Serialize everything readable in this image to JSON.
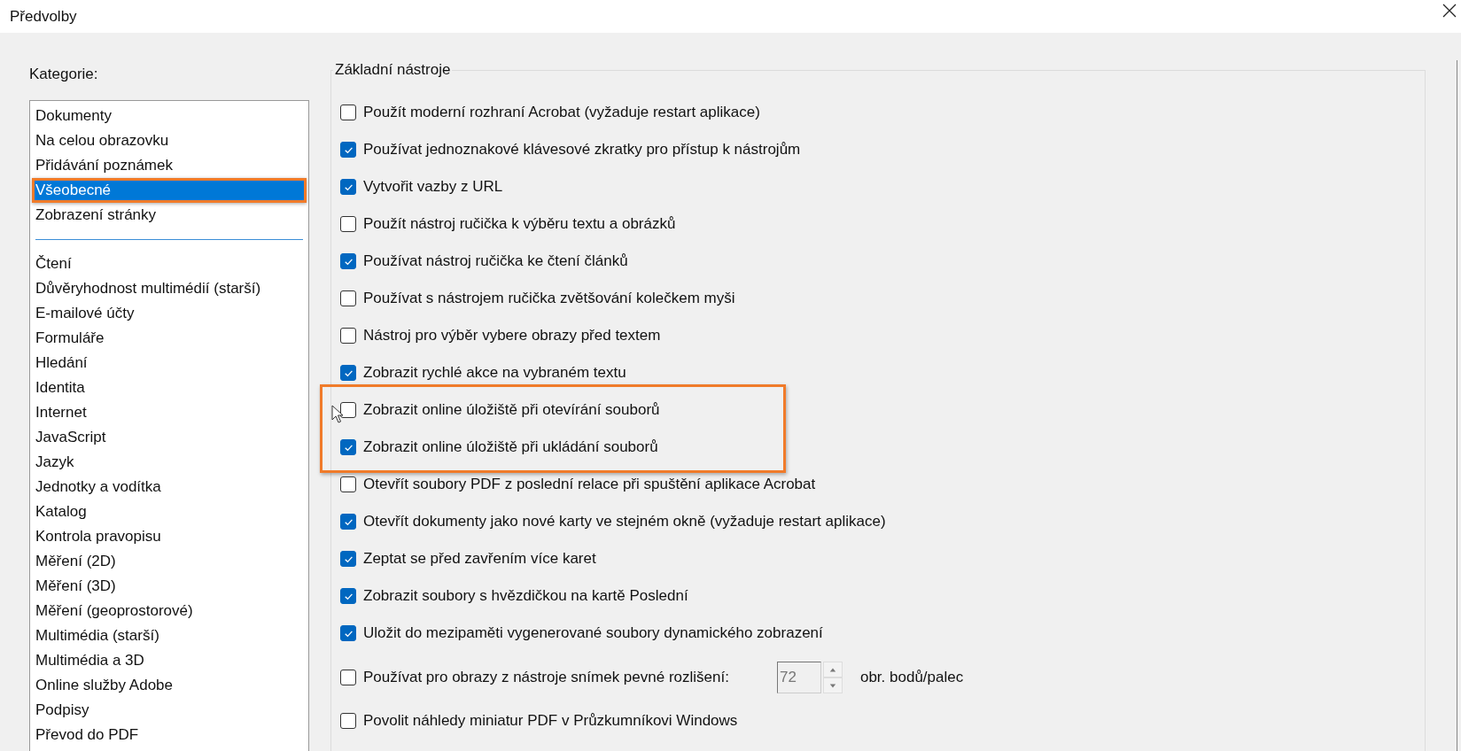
{
  "window": {
    "title": "Předvolby"
  },
  "categories": {
    "label": "Kategorie:",
    "groups": [
      {
        "items": [
          {
            "label": "Dokumenty",
            "selected": false,
            "highlighted": false
          },
          {
            "label": "Na celou obrazovku",
            "selected": false,
            "highlighted": false
          },
          {
            "label": "Přidávání poznámek",
            "selected": false,
            "highlighted": false
          },
          {
            "label": "Všeobecné",
            "selected": true,
            "highlighted": true
          },
          {
            "label": "Zobrazení stránky",
            "selected": false,
            "highlighted": false
          }
        ]
      },
      {
        "items": [
          {
            "label": "Čtení",
            "selected": false,
            "highlighted": false
          },
          {
            "label": "Důvěryhodnost multimédií (starší)",
            "selected": false,
            "highlighted": false
          },
          {
            "label": "E-mailové účty",
            "selected": false,
            "highlighted": false
          },
          {
            "label": "Formuláře",
            "selected": false,
            "highlighted": false
          },
          {
            "label": "Hledání",
            "selected": false,
            "highlighted": false
          },
          {
            "label": "Identita",
            "selected": false,
            "highlighted": false
          },
          {
            "label": "Internet",
            "selected": false,
            "highlighted": false
          },
          {
            "label": "JavaScript",
            "selected": false,
            "highlighted": false
          },
          {
            "label": "Jazyk",
            "selected": false,
            "highlighted": false
          },
          {
            "label": "Jednotky a vodítka",
            "selected": false,
            "highlighted": false
          },
          {
            "label": "Katalog",
            "selected": false,
            "highlighted": false
          },
          {
            "label": "Kontrola pravopisu",
            "selected": false,
            "highlighted": false
          },
          {
            "label": "Měření (2D)",
            "selected": false,
            "highlighted": false
          },
          {
            "label": "Měření (3D)",
            "selected": false,
            "highlighted": false
          },
          {
            "label": "Měření (geoprostorové)",
            "selected": false,
            "highlighted": false
          },
          {
            "label": "Multimédia (starší)",
            "selected": false,
            "highlighted": false
          },
          {
            "label": "Multimédia a 3D",
            "selected": false,
            "highlighted": false
          },
          {
            "label": "Online služby Adobe",
            "selected": false,
            "highlighted": false
          },
          {
            "label": "Podpisy",
            "selected": false,
            "highlighted": false
          },
          {
            "label": "Převod do PDF",
            "selected": false,
            "highlighted": false
          }
        ]
      }
    ]
  },
  "basic_tools": {
    "title": "Základní nástroje",
    "options": [
      {
        "kind": "check",
        "label": "Použít moderní rozhraní Acrobat (vyžaduje restart aplikace)",
        "checked": false,
        "highlighted": false
      },
      {
        "kind": "check",
        "label": "Používat jednoznakové klávesové zkratky pro přístup k nástrojům",
        "checked": true,
        "highlighted": false
      },
      {
        "kind": "check",
        "label": "Vytvořit vazby z URL",
        "checked": true,
        "highlighted": false
      },
      {
        "kind": "check",
        "label": "Použít nástroj ručička k výběru textu a obrázků",
        "checked": false,
        "highlighted": false
      },
      {
        "kind": "check",
        "label": "Používat nástroj ručička ke čtení článků",
        "checked": true,
        "highlighted": false
      },
      {
        "kind": "check",
        "label": "Používat s nástrojem ručička zvětšování kolečkem myši",
        "checked": false,
        "highlighted": false
      },
      {
        "kind": "check",
        "label": "Nástroj pro výběr vybere obrazy před textem",
        "checked": false,
        "highlighted": false
      },
      {
        "kind": "check",
        "label": "Zobrazit rychlé akce na vybraném textu",
        "checked": true,
        "highlighted": false
      },
      {
        "kind": "check",
        "label": "Zobrazit online úložiště při otevírání souborů",
        "checked": false,
        "highlighted": true
      },
      {
        "kind": "check",
        "label": "Zobrazit online úložiště při ukládání souborů",
        "checked": true,
        "highlighted": true
      },
      {
        "kind": "check",
        "label": "Otevřít soubory PDF z poslední relace při spuštění aplikace Acrobat",
        "checked": false,
        "highlighted": false
      },
      {
        "kind": "check",
        "label": "Otevřít dokumenty jako nové karty ve stejném okně (vyžaduje restart aplikace)",
        "checked": true,
        "highlighted": false
      },
      {
        "kind": "check",
        "label": "Zeptat se před zavřením více karet",
        "checked": true,
        "highlighted": false
      },
      {
        "kind": "check",
        "label": "Zobrazit soubory s hvězdičkou na kartě Poslední",
        "checked": true,
        "highlighted": false
      },
      {
        "kind": "check",
        "label": "Uložit do mezipaměti vygenerované soubory dynamického zobrazení",
        "checked": true,
        "highlighted": false
      },
      {
        "kind": "spin",
        "label": "Používat pro obrazy z nástroje snímek pevné rozlišení:",
        "checked": false,
        "highlighted": false,
        "value": "72",
        "unit": "obr. bodů/palec"
      },
      {
        "kind": "check",
        "label": "Povolit náhledy miniatur PDF v Průzkumníkovi Windows",
        "checked": false,
        "highlighted": false
      }
    ]
  }
}
